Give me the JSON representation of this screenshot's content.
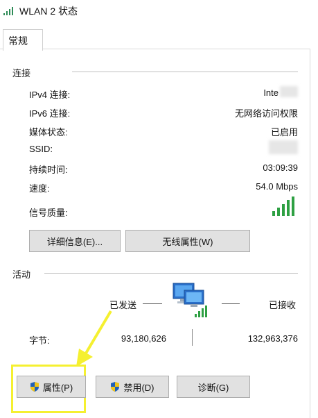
{
  "window": {
    "title": "WLAN 2 状态"
  },
  "tabs": [
    {
      "label": "常规"
    }
  ],
  "connection": {
    "section_label": "连接",
    "rows": [
      {
        "label": "IPv4 连接:",
        "value": "Inte"
      },
      {
        "label": "IPv6 连接:",
        "value": "无网络访问权限"
      },
      {
        "label": "媒体状态:",
        "value": "已启用"
      },
      {
        "label": "SSID:",
        "value": ""
      },
      {
        "label": "持续时间:",
        "value": "03:09:39"
      },
      {
        "label": "速度:",
        "value": "54.0 Mbps"
      },
      {
        "label": "信号质量:",
        "value": ""
      }
    ],
    "details_button": "详细信息(E)...",
    "wireless_button": "无线属性(W)"
  },
  "activity": {
    "section_label": "活动",
    "sent_label": "已发送",
    "received_label": "已接收",
    "bytes_label": "字节:",
    "bytes_sent": "93,180,626",
    "bytes_received": "132,963,376"
  },
  "footer": {
    "properties_button": "属性(P)",
    "disable_button": "禁用(D)",
    "diagnose_button": "诊断(G)"
  },
  "colors": {
    "signal": "#2ea043",
    "highlight": "#f5f030",
    "arrow": "#f5f030"
  }
}
